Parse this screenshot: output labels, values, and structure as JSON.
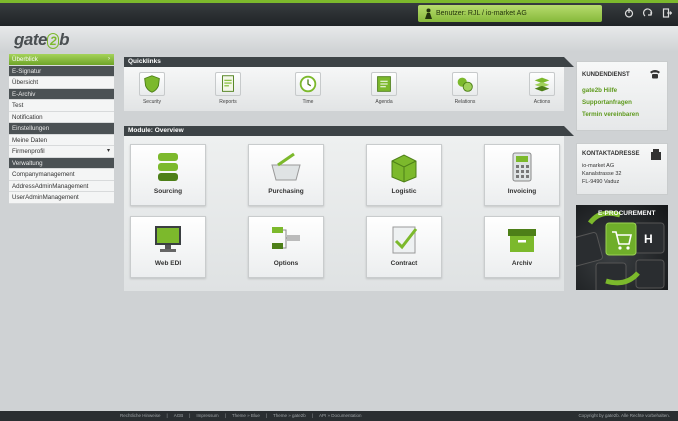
{
  "topbar": {
    "user": "Benutzer: RJL / io-market AG",
    "icons": [
      "power-icon",
      "refresh-icon",
      "logout-icon"
    ]
  },
  "logo": {
    "prefix": "gate",
    "two": "2",
    "suffix": "b"
  },
  "sidebar": {
    "items": [
      {
        "label": "Überblick",
        "kind": "active"
      },
      {
        "label": "E-Signatur",
        "kind": "section"
      },
      {
        "label": "Übersicht",
        "kind": "item"
      },
      {
        "label": "E-Archiv",
        "kind": "section"
      },
      {
        "label": "Test",
        "kind": "item"
      },
      {
        "label": "Notification",
        "kind": "item"
      },
      {
        "label": "Einstellungen",
        "kind": "section"
      },
      {
        "label": "Meine Daten",
        "kind": "item"
      },
      {
        "label": "Firmenprofil",
        "kind": "item",
        "arrow": "▾"
      },
      {
        "label": "Verwaltung",
        "kind": "section"
      },
      {
        "label": "Companymanagement",
        "kind": "item"
      },
      {
        "label": "AddressAdminManagement",
        "kind": "item"
      },
      {
        "label": "UserAdminManagement",
        "kind": "item"
      }
    ]
  },
  "quicklinks": {
    "title": "Quicklinks",
    "items": [
      {
        "label": "Security",
        "icon": "shield-icon"
      },
      {
        "label": "Reports",
        "icon": "report-icon"
      },
      {
        "label": "Time",
        "icon": "clock-icon"
      },
      {
        "label": "Agenda",
        "icon": "agenda-icon"
      },
      {
        "label": "Relations",
        "icon": "relations-icon"
      },
      {
        "label": "Actions",
        "icon": "actions-icon"
      }
    ]
  },
  "modules": {
    "title": "Module: Overview",
    "items": [
      {
        "label": "Sourcing",
        "icon": "sourcing-icon"
      },
      {
        "label": "Purchasing",
        "icon": "basket-icon"
      },
      {
        "label": "Logistic",
        "icon": "box-icon"
      },
      {
        "label": "Invoicing",
        "icon": "calculator-icon"
      },
      {
        "label": "Web EDI",
        "icon": "monitor-icon"
      },
      {
        "label": "Options",
        "icon": "options-icon"
      },
      {
        "label": "Contract",
        "icon": "contract-icon"
      },
      {
        "label": "Archiv",
        "icon": "archive-icon"
      }
    ]
  },
  "kundendienst": {
    "title": "KUNDENDIENST",
    "links": [
      "gate2b Hilfe",
      "Supportanfragen",
      "Termin vereinbaren"
    ]
  },
  "kontakt": {
    "title": "KONTAKTADRESSE",
    "lines": [
      "io-market AG",
      "Kanalstrasse 32",
      "FL-9490 Vaduz"
    ]
  },
  "eprocurement": {
    "title": "E-PROCUREMENT"
  },
  "footer": {
    "links": [
      "Rechtliche Hinweise",
      "AGB",
      "Impressum",
      "Theme » Blue",
      "Theme » gate2b",
      "API » Documentation"
    ],
    "copyright": "Copyright by gate2b. Alle Rechte vorbehalten."
  },
  "colors": {
    "accent": "#7cb92c",
    "dark": "#3d4346"
  }
}
